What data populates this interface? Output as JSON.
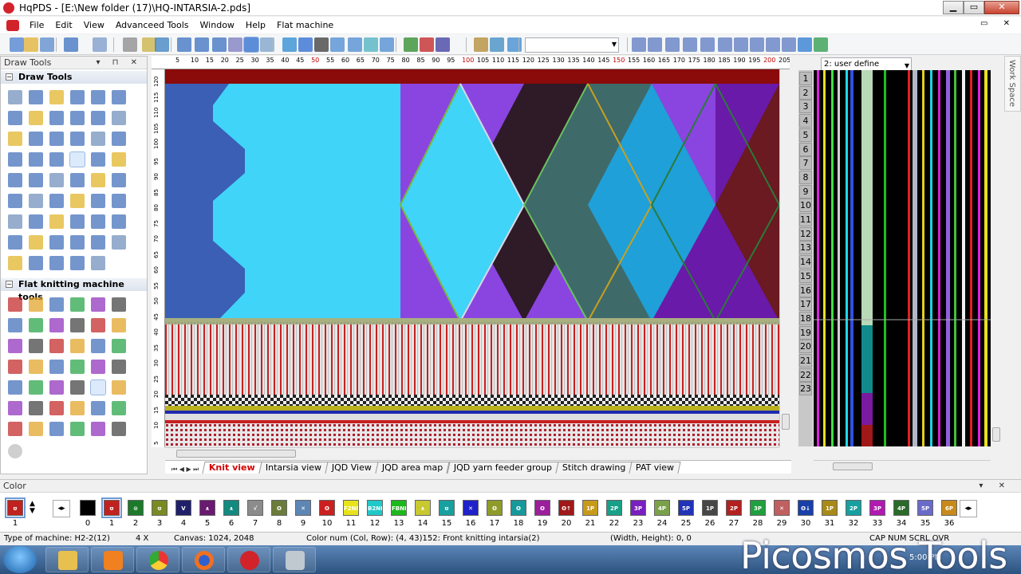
{
  "window": {
    "title": "HqPDS - [E:\\New folder (17)\\HQ-INTARSIA-2.pds]"
  },
  "menu": [
    "File",
    "Edit",
    "View",
    "Advanceed Tools",
    "Window",
    "Help",
    "Flat machine"
  ],
  "mdi_controls": "▭ ✕",
  "panels": {
    "draw_tools_title": "Draw Tools",
    "draw_tools_group": "Draw Tools",
    "flat_tools_group": "Flat knitting machine tools",
    "panel_controls": "▾ ⊓ ✕"
  },
  "ruler": {
    "top": [
      "5",
      "10",
      "15",
      "20",
      "25",
      "30",
      "35",
      "40",
      "45",
      "50",
      "55",
      "60",
      "65",
      "70",
      "75",
      "80",
      "85",
      "90",
      "95",
      "100",
      "105",
      "110",
      "115",
      "120",
      "125",
      "130",
      "135",
      "140",
      "145",
      "150",
      "155",
      "160",
      "165",
      "170",
      "175",
      "180",
      "185",
      "190",
      "195",
      "200",
      "205"
    ],
    "left": [
      "120",
      "115",
      "110",
      "105",
      "100",
      "95",
      "90",
      "85",
      "80",
      "75",
      "70",
      "65",
      "60",
      "55",
      "50",
      "45",
      "40",
      "35",
      "30",
      "25",
      "20",
      "15",
      "10",
      "5"
    ]
  },
  "tabs": [
    {
      "label": "Knit view",
      "active": true
    },
    {
      "label": "Intarsia view",
      "active": false
    },
    {
      "label": "JQD View",
      "active": false
    },
    {
      "label": "JQD area map",
      "active": false
    },
    {
      "label": "JQD yarn feeder group",
      "active": false
    },
    {
      "label": "Stitch drawing",
      "active": false
    },
    {
      "label": "PAT view",
      "active": false
    }
  ],
  "tab_nav": "⏮ ◀ ▶ ⏭",
  "yarn_panel": {
    "combo": "2: user define",
    "rows": [
      "1",
      "2",
      "3",
      "4",
      "5",
      "6",
      "7",
      "8",
      "9",
      "10",
      "11",
      "12",
      "13",
      "14",
      "15",
      "16",
      "17",
      "18",
      "19",
      "20",
      "21",
      "22",
      "23"
    ]
  },
  "workspace_label": "Work Space",
  "color_panel": {
    "title": "Color",
    "current": "1",
    "swatches": [
      {
        "n": "0",
        "c": "#000000",
        "t": ""
      },
      {
        "n": "1",
        "c": "#c0231f",
        "t": "ʊ"
      },
      {
        "n": "2",
        "c": "#1d7a2b",
        "t": "⊙"
      },
      {
        "n": "3",
        "c": "#7a8a23",
        "t": "ʊ"
      },
      {
        "n": "4",
        "c": "#20206a",
        "t": "V"
      },
      {
        "n": "5",
        "c": "#6a1a70",
        "t": "∧"
      },
      {
        "n": "6",
        "c": "#138a80",
        "t": "∧"
      },
      {
        "n": "7",
        "c": "#8c8c8c",
        "t": "√"
      },
      {
        "n": "8",
        "c": "#6b7c3a",
        "t": "ʘ"
      },
      {
        "n": "9",
        "c": "#5d86b5",
        "t": "✕"
      },
      {
        "n": "10",
        "c": "#cc1f1f",
        "t": "ʘ"
      },
      {
        "n": "11",
        "c": "#e8e31a",
        "t": "F2ND"
      },
      {
        "n": "12",
        "c": "#20c8c8",
        "t": "B2ND"
      },
      {
        "n": "13",
        "c": "#1db81d",
        "t": "FBNB"
      },
      {
        "n": "14",
        "c": "#c8c830",
        "t": "∧"
      },
      {
        "n": "15",
        "c": "#18a0a0",
        "t": "ʊ"
      },
      {
        "n": "16",
        "c": "#1e22c8",
        "t": "✕"
      },
      {
        "n": "17",
        "c": "#8f9c2a",
        "t": "ʘ"
      },
      {
        "n": "18",
        "c": "#17999b",
        "t": "ʘ"
      },
      {
        "n": "19",
        "c": "#9b1f9b",
        "t": "ʘ"
      },
      {
        "n": "20",
        "c": "#a01818",
        "t": "ʘ↑"
      },
      {
        "n": "21",
        "c": "#c89a1a",
        "t": "1P"
      },
      {
        "n": "22",
        "c": "#18a088",
        "t": "2P"
      },
      {
        "n": "23",
        "c": "#7a1fbf",
        "t": "3P"
      },
      {
        "n": "24",
        "c": "#7ba04a",
        "t": "4P"
      },
      {
        "n": "25",
        "c": "#2233b8",
        "t": "5P"
      },
      {
        "n": "26",
        "c": "#474747",
        "t": "1P"
      },
      {
        "n": "27",
        "c": "#b32020",
        "t": "2P"
      },
      {
        "n": "28",
        "c": "#20a040",
        "t": "3P"
      },
      {
        "n": "29",
        "c": "#c06060",
        "t": "✕"
      },
      {
        "n": "30",
        "c": "#1a3fa8",
        "t": "ʘ↓"
      },
      {
        "n": "31",
        "c": "#a88a18",
        "t": "1P"
      },
      {
        "n": "32",
        "c": "#18a0a0",
        "t": "2P"
      },
      {
        "n": "33",
        "c": "#b01ab0",
        "t": "3P"
      },
      {
        "n": "34",
        "c": "#2a6a2a",
        "t": "4P"
      },
      {
        "n": "35",
        "c": "#6a6ac8",
        "t": "5P"
      },
      {
        "n": "36",
        "c": "#c88a1a",
        "t": "6P"
      }
    ]
  },
  "status": {
    "machine": "Type of machine: H2-2(12)",
    "zoom": "4 X",
    "canvas": "Canvas: 1024, 2048",
    "colornum": "Color num  (Col, Row): (4, 43)152: Front knitting intarsia(2)",
    "size": "(Width, Height): 0, 0",
    "keys": "CAP  NUM  SCRL  OVR"
  },
  "watermark": "Picosmos Tools",
  "tray_text": "5:00 PM"
}
